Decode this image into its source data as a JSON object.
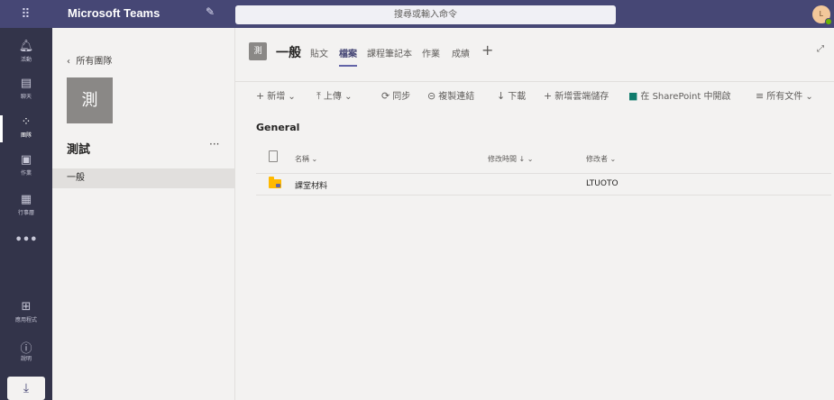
{
  "app": {
    "title": "Microsoft Teams",
    "search_placeholder": "搜尋或輸入命令",
    "avatar_initial": "L"
  },
  "rail": [
    {
      "label": "活動",
      "icon": "bell-icon"
    },
    {
      "label": "聊天",
      "icon": "chat-icon"
    },
    {
      "label": "團隊",
      "icon": "teams-icon"
    },
    {
      "label": "作業",
      "icon": "assignments-icon"
    },
    {
      "label": "行事曆",
      "icon": "calendar-icon"
    },
    {
      "label": "應用程式",
      "icon": "apps-icon"
    },
    {
      "label": "說明",
      "icon": "help-icon"
    }
  ],
  "sidepanel": {
    "back_label": "所有團隊",
    "team_tile_char": "測",
    "team_name": "測試",
    "channels": [
      "一般"
    ]
  },
  "channel": {
    "tile_char": "測",
    "name": "一般",
    "tabs": [
      "貼文",
      "檔案",
      "課程筆記本",
      "作業",
      "成績"
    ],
    "active_tab": "檔案"
  },
  "commands": {
    "new": "新增",
    "upload": "上傳",
    "sync": "同步",
    "copy_link": "複製連結",
    "download": "下載",
    "add_cloud": "新增雲端儲存",
    "open_sharepoint": "在 SharePoint 中開啟",
    "all_docs": "所有文件"
  },
  "files": {
    "section": "General",
    "columns": {
      "name": "名稱",
      "modified": "修改時間 ↓",
      "modified_by": "修改者"
    },
    "rows": [
      {
        "name": "課堂材料",
        "modified": "",
        "modified_by": "LTUOTO"
      }
    ]
  }
}
